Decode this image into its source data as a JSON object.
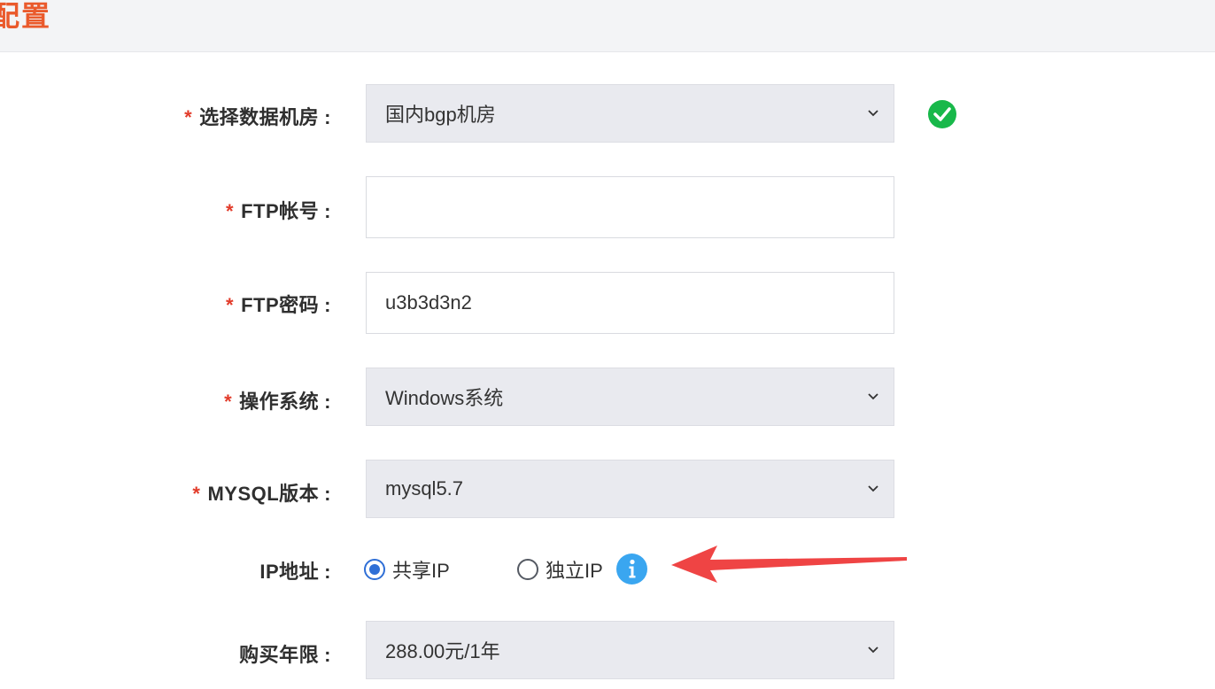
{
  "header": {
    "title": "配置"
  },
  "form": {
    "rows": [
      {
        "required": "*",
        "label": "选择数据机房",
        "colon": ":",
        "value": "国内bgp机房",
        "type": "select"
      },
      {
        "required": "*",
        "label": "FTP帐号",
        "colon": ":",
        "value": "",
        "type": "input"
      },
      {
        "required": "*",
        "label": "FTP密码",
        "colon": ":",
        "value": "u3b3d3n2",
        "type": "input"
      },
      {
        "required": "*",
        "label": "操作系统",
        "colon": ":",
        "value": "Windows系统",
        "type": "select"
      },
      {
        "required": "*",
        "label": "MYSQL版本",
        "colon": ":",
        "value": "mysql5.7",
        "type": "select"
      },
      {
        "label": "IP地址",
        "colon": ":",
        "type": "radio"
      },
      {
        "label": "购买年限",
        "colon": ":",
        "value": "288.00元/1年",
        "type": "select"
      }
    ],
    "ip_options": [
      {
        "label": "共享IP",
        "checked": true
      },
      {
        "label": "独立IP",
        "checked": false
      }
    ]
  },
  "icons": {
    "datacenter_status": "check-circle-icon",
    "ip_help": "info-icon",
    "annotation": "arrow-icon"
  },
  "colors": {
    "title": "#ea5a2c",
    "required": "#e23b2a",
    "radio_selected": "#2f6fd6",
    "success": "#18b84a",
    "info": "#3aa6f0",
    "annotation_arrow": "#ef4444"
  }
}
